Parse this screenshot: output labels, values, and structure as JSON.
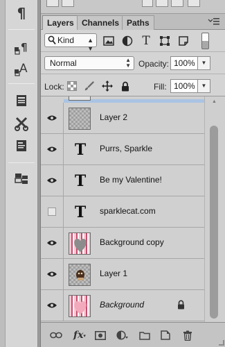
{
  "toolstrip": {
    "tools": [
      {
        "icon": "paragraph-icon",
        "glyph": "¶"
      },
      {
        "icon": "paragraph-styles-icon"
      },
      {
        "icon": "character-styles-icon"
      },
      {
        "icon": "notes-icon"
      },
      {
        "icon": "tool-presets-icon"
      },
      {
        "icon": "properties-icon"
      },
      {
        "icon": "layer-comps-icon"
      }
    ]
  },
  "tabs": [
    {
      "label": "Layers",
      "active": true
    },
    {
      "label": "Channels",
      "active": false
    },
    {
      "label": "Paths",
      "active": false
    }
  ],
  "filter": {
    "kind_label": "Kind",
    "text_filter_glyph": "T"
  },
  "blend": {
    "mode": "Normal",
    "opacity_label": "Opacity:",
    "opacity_value": "100%"
  },
  "lock": {
    "label": "Lock:",
    "fill_label": "Fill:",
    "fill_value": "100%"
  },
  "layers": [
    {
      "name": "Layer 2",
      "type": "transparent",
      "visible": true
    },
    {
      "name": "Purrs, Sparkle",
      "type": "text",
      "visible": true,
      "glyph": "T"
    },
    {
      "name": "Be my Valentine!",
      "type": "text",
      "visible": true,
      "glyph": "T"
    },
    {
      "name": "sparklecat.com",
      "type": "text",
      "visible": false,
      "glyph": "T"
    },
    {
      "name": "Background copy",
      "type": "pink-heart",
      "visible": true
    },
    {
      "name": "Layer 1",
      "type": "photo",
      "visible": true
    },
    {
      "name": "Background",
      "type": "pink-heart",
      "visible": true,
      "italic": true,
      "locked": true
    }
  ],
  "footer": {
    "fx_label": "fx"
  },
  "colors": {
    "panel_bg": "#d4d4d4",
    "selection_blue": "#a9c3e3",
    "pink_stripe": "#c24d6d"
  }
}
